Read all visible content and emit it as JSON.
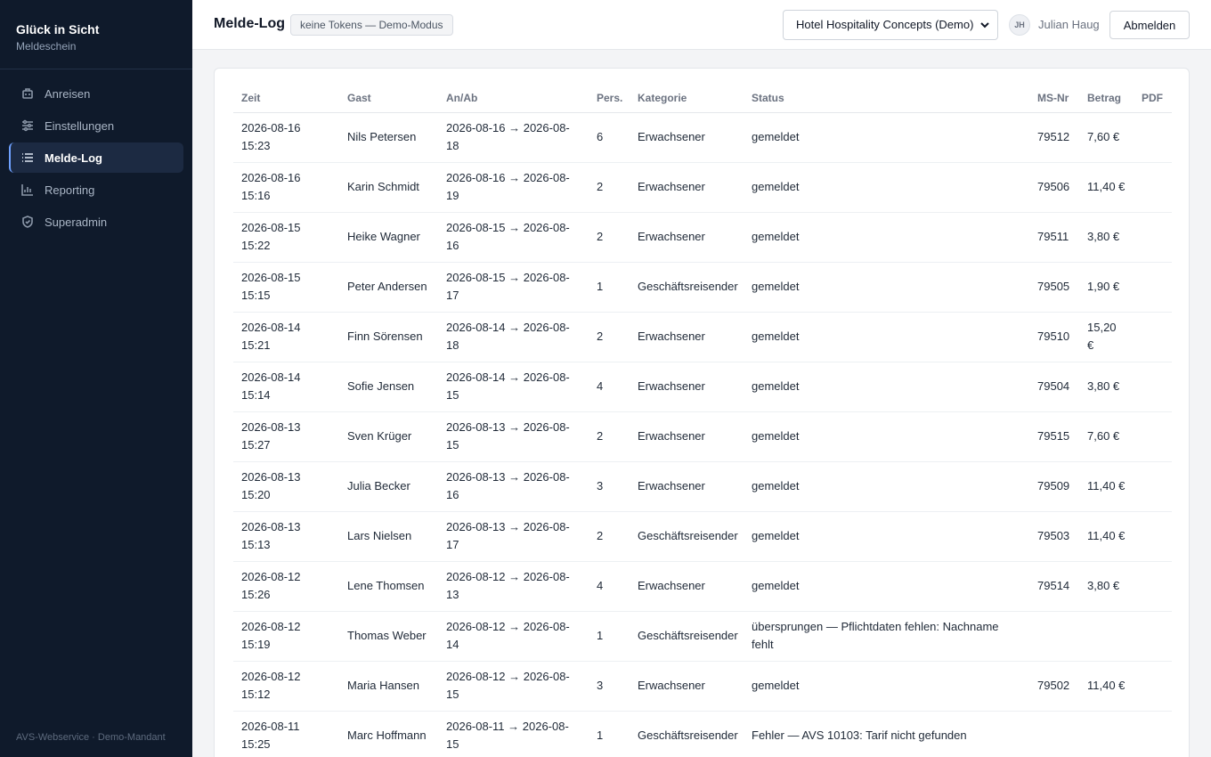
{
  "brand": {
    "title": "Glück in Sicht",
    "subtitle": "Meldeschein"
  },
  "sidebar": {
    "items": [
      {
        "label": "Anreisen",
        "icon": "luggage-icon",
        "active": false
      },
      {
        "label": "Einstellungen",
        "icon": "sliders-icon",
        "active": false
      },
      {
        "label": "Melde-Log",
        "icon": "list-icon",
        "active": true
      },
      {
        "label": "Reporting",
        "icon": "bar-chart-icon",
        "active": false
      },
      {
        "label": "Superadmin",
        "icon": "shield-icon",
        "active": false
      }
    ],
    "footer": "AVS-Webservice · Demo-Mandant"
  },
  "header": {
    "title": "Melde-Log",
    "badge": "keine Tokens — Demo-Modus",
    "tenant": "Hotel Hospitality Concepts (Demo)",
    "avatar_initials": "JH",
    "user_name": "Julian Haug",
    "logout_label": "Abmelden"
  },
  "table": {
    "columns": [
      "Zeit",
      "Gast",
      "An/Ab",
      "Pers.",
      "Kategorie",
      "Status",
      "MS-Nr",
      "Betrag",
      "PDF"
    ],
    "rows": [
      [
        "2026-08-16 15:23",
        "Nils Petersen",
        "2026-08-16 → 2026-08-18",
        "6",
        "Erwachsener",
        "gemeldet",
        "79512",
        "7,60 €",
        ""
      ],
      [
        "2026-08-16 15:16",
        "Karin Schmidt",
        "2026-08-16 → 2026-08-19",
        "2",
        "Erwachsener",
        "gemeldet",
        "79506",
        "11,40 €",
        ""
      ],
      [
        "2026-08-15 15:22",
        "Heike Wagner",
        "2026-08-15 → 2026-08-16",
        "2",
        "Erwachsener",
        "gemeldet",
        "79511",
        "3,80 €",
        ""
      ],
      [
        "2026-08-15 15:15",
        "Peter Andersen",
        "2026-08-15 → 2026-08-17",
        "1",
        "Geschäftsreisender",
        "gemeldet",
        "79505",
        "1,90 €",
        ""
      ],
      [
        "2026-08-14 15:21",
        "Finn Sörensen",
        "2026-08-14 → 2026-08-18",
        "2",
        "Erwachsener",
        "gemeldet",
        "79510",
        "15,20 €",
        ""
      ],
      [
        "2026-08-14 15:14",
        "Sofie Jensen",
        "2026-08-14 → 2026-08-15",
        "4",
        "Erwachsener",
        "gemeldet",
        "79504",
        "3,80 €",
        ""
      ],
      [
        "2026-08-13 15:27",
        "Sven Krüger",
        "2026-08-13 → 2026-08-15",
        "2",
        "Erwachsener",
        "gemeldet",
        "79515",
        "7,60 €",
        ""
      ],
      [
        "2026-08-13 15:20",
        "Julia Becker",
        "2026-08-13 → 2026-08-16",
        "3",
        "Erwachsener",
        "gemeldet",
        "79509",
        "11,40 €",
        ""
      ],
      [
        "2026-08-13 15:13",
        "Lars Nielsen",
        "2026-08-13 → 2026-08-17",
        "2",
        "Geschäftsreisender",
        "gemeldet",
        "79503",
        "11,40 €",
        ""
      ],
      [
        "2026-08-12 15:26",
        "Lene Thomsen",
        "2026-08-12 → 2026-08-13",
        "4",
        "Erwachsener",
        "gemeldet",
        "79514",
        "3,80 €",
        ""
      ],
      [
        "2026-08-12 15:19",
        "Thomas Weber",
        "2026-08-12 → 2026-08-14",
        "1",
        "Geschäftsreisender",
        "übersprungen — Pflichtdaten fehlen: Nachname fehlt",
        "",
        "",
        ""
      ],
      [
        "2026-08-12 15:12",
        "Maria Hansen",
        "2026-08-12 → 2026-08-15",
        "3",
        "Erwachsener",
        "gemeldet",
        "79502",
        "11,40 €",
        ""
      ],
      [
        "2026-08-11 15:25",
        "Marc Hoffmann",
        "2026-08-11 → 2026-08-15",
        "1",
        "Geschäftsreisender",
        "Fehler — AVS 10103: Tarif nicht gefunden",
        "",
        "",
        ""
      ]
    ]
  }
}
